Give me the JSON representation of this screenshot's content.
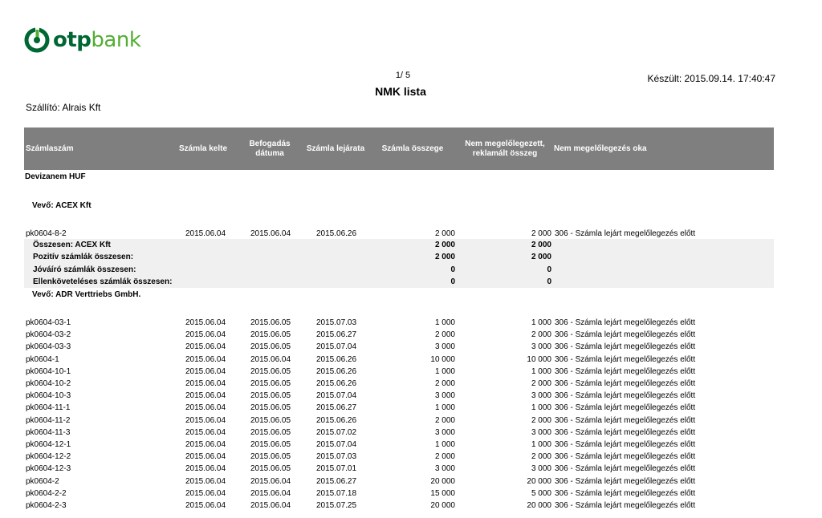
{
  "logo": {
    "otp": "otp",
    "bank": "bank"
  },
  "header": {
    "page": "1/ 5",
    "created": "Készült: 2015.09.14. 17:40:47",
    "title": "NMK lista",
    "supplier": "Szállító: Alrais Kft"
  },
  "columns": {
    "number": "Számlaszám",
    "date": "Számla kelte",
    "accepted": "Befogadás dátuma",
    "due": "Számla lejárata",
    "amount": "Számla összege",
    "unadvanced": "Nem megelőlegezett, reklamált összeg",
    "reason": "Nem megelőlegezés oka"
  },
  "currency_label": "Devizanem HUF",
  "buyers": [
    {
      "label": "Vevő: ACEX Kft",
      "rows": [
        {
          "number": "pk0604-8-2",
          "date": "2015.06.04",
          "accepted": "2015.06.04",
          "due": "2015.06.26",
          "amount": "2 000",
          "unadvanced": "2 000",
          "reason": "306 - Számla lejárt megelőlegezés előtt"
        }
      ],
      "summary": [
        {
          "label": "Összesen: ACEX Kft",
          "amount": "2 000",
          "unadvanced": "2 000"
        },
        {
          "label": "Pozitív számlák összesen:",
          "amount": "2 000",
          "unadvanced": "2 000"
        },
        {
          "label": "Jóváíró számlák összesen:",
          "amount": "0",
          "unadvanced": "0"
        },
        {
          "label": "Ellenköveteléses számlák összesen:",
          "amount": "0",
          "unadvanced": "0"
        }
      ]
    },
    {
      "label": "Vevő: ADR Verttriebs GmbH.",
      "rows": [
        {
          "number": "pk0604-03-1",
          "date": "2015.06.04",
          "accepted": "2015.06.05",
          "due": "2015.07.03",
          "amount": "1 000",
          "unadvanced": "1 000",
          "reason": "306 - Számla lejárt megelőlegezés előtt"
        },
        {
          "number": "pk0604-03-2",
          "date": "2015.06.04",
          "accepted": "2015.06.05",
          "due": "2015.06.27",
          "amount": "2 000",
          "unadvanced": "2 000",
          "reason": "306 - Számla lejárt megelőlegezés előtt"
        },
        {
          "number": "pk0604-03-3",
          "date": "2015.06.04",
          "accepted": "2015.06.05",
          "due": "2015.07.04",
          "amount": "3 000",
          "unadvanced": "3 000",
          "reason": "306 - Számla lejárt megelőlegezés előtt"
        },
        {
          "number": "pk0604-1",
          "date": "2015.06.04",
          "accepted": "2015.06.04",
          "due": "2015.06.26",
          "amount": "10 000",
          "unadvanced": "10 000",
          "reason": "306 - Számla lejárt megelőlegezés előtt"
        },
        {
          "number": "pk0604-10-1",
          "date": "2015.06.04",
          "accepted": "2015.06.05",
          "due": "2015.06.26",
          "amount": "1 000",
          "unadvanced": "1 000",
          "reason": "306 - Számla lejárt megelőlegezés előtt"
        },
        {
          "number": "pk0604-10-2",
          "date": "2015.06.04",
          "accepted": "2015.06.05",
          "due": "2015.06.26",
          "amount": "2 000",
          "unadvanced": "2 000",
          "reason": "306 - Számla lejárt megelőlegezés előtt"
        },
        {
          "number": "pk0604-10-3",
          "date": "2015.06.04",
          "accepted": "2015.06.05",
          "due": "2015.07.04",
          "amount": "3 000",
          "unadvanced": "3 000",
          "reason": "306 - Számla lejárt megelőlegezés előtt"
        },
        {
          "number": "pk0604-11-1",
          "date": "2015.06.04",
          "accepted": "2015.06.05",
          "due": "2015.06.27",
          "amount": "1 000",
          "unadvanced": "1 000",
          "reason": "306 - Számla lejárt megelőlegezés előtt"
        },
        {
          "number": "pk0604-11-2",
          "date": "2015.06.04",
          "accepted": "2015.06.05",
          "due": "2015.06.26",
          "amount": "2 000",
          "unadvanced": "2 000",
          "reason": "306 - Számla lejárt megelőlegezés előtt"
        },
        {
          "number": "pk0604-11-3",
          "date": "2015.06.04",
          "accepted": "2015.06.05",
          "due": "2015.07.02",
          "amount": "3 000",
          "unadvanced": "3 000",
          "reason": "306 - Számla lejárt megelőlegezés előtt"
        },
        {
          "number": "pk0604-12-1",
          "date": "2015.06.04",
          "accepted": "2015.06.05",
          "due": "2015.07.04",
          "amount": "1 000",
          "unadvanced": "1 000",
          "reason": "306 - Számla lejárt megelőlegezés előtt"
        },
        {
          "number": "pk0604-12-2",
          "date": "2015.06.04",
          "accepted": "2015.06.05",
          "due": "2015.07.03",
          "amount": "2 000",
          "unadvanced": "2 000",
          "reason": "306 - Számla lejárt megelőlegezés előtt"
        },
        {
          "number": "pk0604-12-3",
          "date": "2015.06.04",
          "accepted": "2015.06.05",
          "due": "2015.07.01",
          "amount": "3 000",
          "unadvanced": "3 000",
          "reason": "306 - Számla lejárt megelőlegezés előtt"
        },
        {
          "number": "pk0604-2",
          "date": "2015.06.04",
          "accepted": "2015.06.04",
          "due": "2015.06.27",
          "amount": "20 000",
          "unadvanced": "20 000",
          "reason": "306 - Számla lejárt megelőlegezés előtt"
        },
        {
          "number": "pk0604-2-2",
          "date": "2015.06.04",
          "accepted": "2015.06.04",
          "due": "2015.07.18",
          "amount": "15 000",
          "unadvanced": "5 000",
          "reason": "306 - Számla lejárt megelőlegezés előtt"
        },
        {
          "number": "pk0604-2-3",
          "date": "2015.06.04",
          "accepted": "2015.06.04",
          "due": "2015.07.25",
          "amount": "20 000",
          "unadvanced": "20 000",
          "reason": "306 - Számla lejárt megelőlegezés előtt"
        }
      ]
    }
  ],
  "colors": {
    "header_bg": "#7f7f7f",
    "summary_bg": "#f0f0f0",
    "brand_dark": "#006633",
    "brand_light": "#52ae32"
  }
}
